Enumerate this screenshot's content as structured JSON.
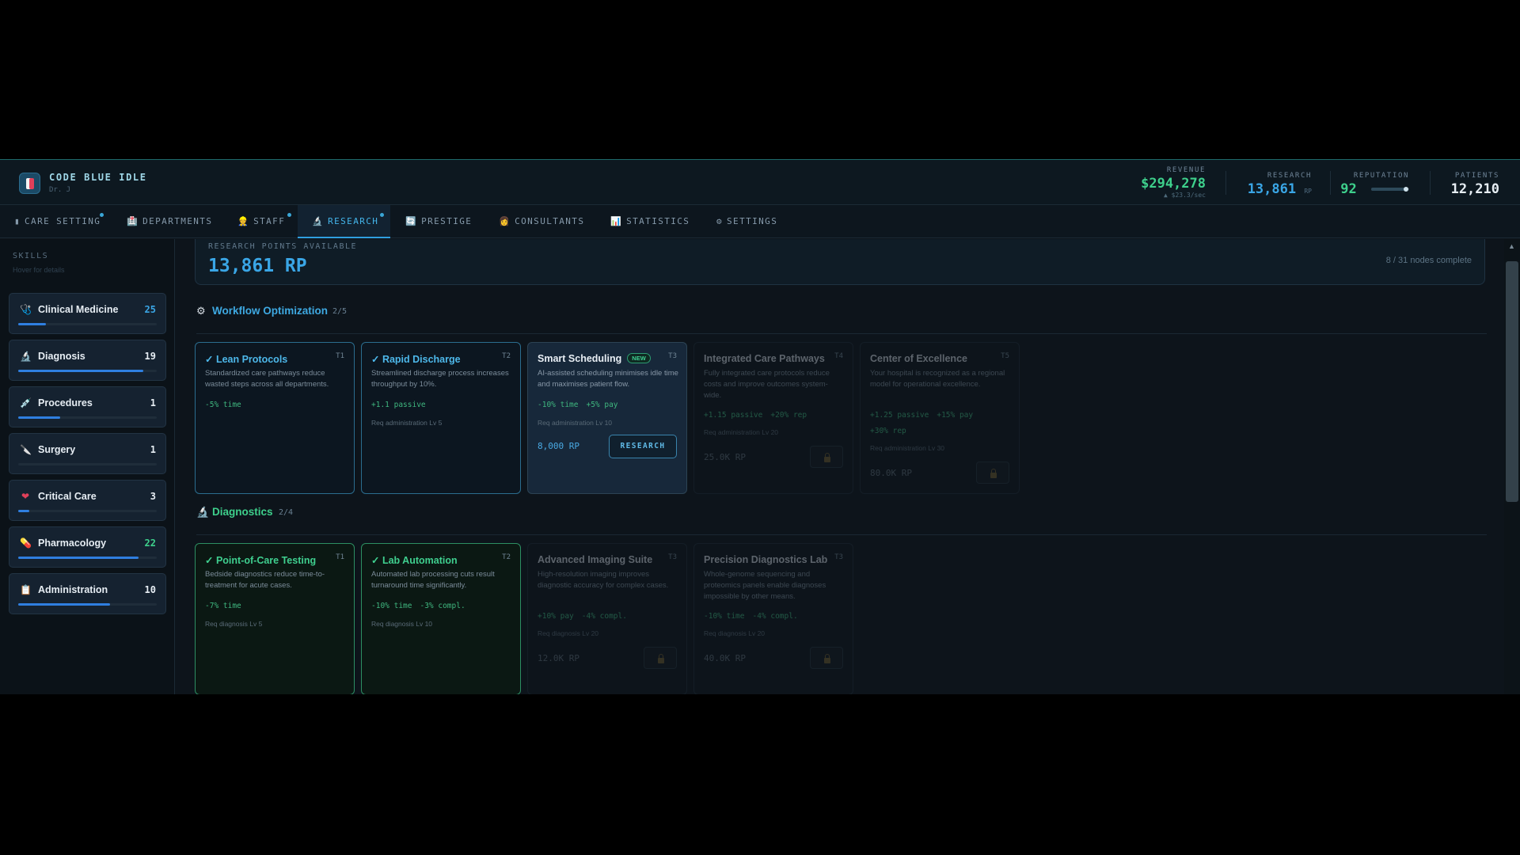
{
  "app": {
    "title": "CODE BLUE IDLE",
    "subtitle": "Dr. J"
  },
  "stats": {
    "revenue": {
      "label": "REVENUE",
      "value": "$294,278",
      "rate": "▲ $23.3/sec",
      "color": "#3ed08c"
    },
    "research": {
      "label": "RESEARCH",
      "value": "13,861",
      "unit": "RP",
      "color": "#3aa6e6"
    },
    "reputation": {
      "label": "REPUTATION",
      "value": "92",
      "level": 0.92,
      "color": "#3ed08c"
    },
    "patients": {
      "label": "PATIENTS",
      "value": "12,210",
      "color": "#e6edf3"
    }
  },
  "tabs": [
    {
      "label": "CARE SETTING",
      "icon": "bed-icon",
      "glyph": "▮",
      "notify": true,
      "active": false
    },
    {
      "label": "DEPARTMENTS",
      "icon": "hospital-icon",
      "glyph": "🏥",
      "notify": false,
      "active": false
    },
    {
      "label": "STAFF",
      "icon": "staff-icon",
      "glyph": "👷",
      "notify": true,
      "active": false
    },
    {
      "label": "RESEARCH",
      "icon": "microscope-icon",
      "glyph": "🔬",
      "notify": true,
      "active": true
    },
    {
      "label": "PRESTIGE",
      "icon": "prestige-icon",
      "glyph": "🔄",
      "notify": false,
      "active": false
    },
    {
      "label": "CONSULTANTS",
      "icon": "consultant-icon",
      "glyph": "👩",
      "notify": false,
      "active": false
    },
    {
      "label": "STATISTICS",
      "icon": "chart-icon",
      "glyph": "📊",
      "notify": false,
      "active": false
    },
    {
      "label": "SETTINGS",
      "icon": "gear-icon",
      "glyph": "⚙",
      "notify": false,
      "active": false
    }
  ],
  "sidebar": {
    "title": "SKILLS",
    "hint": "Hover for details",
    "skills": [
      {
        "name": "Clinical Medicine",
        "level": "25",
        "progress": 0.2,
        "icon": "stethoscope-icon",
        "glyph": "🩺",
        "level_color": "#3aa6e6"
      },
      {
        "name": "Diagnosis",
        "level": "19",
        "progress": 0.9,
        "icon": "microscope-icon",
        "glyph": "🔬",
        "level_color": "#e6edf3"
      },
      {
        "name": "Procedures",
        "level": "1",
        "progress": 0.3,
        "icon": "syringe-icon",
        "glyph": "💉",
        "level_color": "#e6edf3"
      },
      {
        "name": "Surgery",
        "level": "1",
        "progress": 0.0,
        "icon": "scalpel-icon",
        "glyph": "🔪",
        "level_color": "#e6edf3"
      },
      {
        "name": "Critical Care",
        "level": "3",
        "progress": 0.08,
        "icon": "heart-icon",
        "glyph": "❤",
        "level_color": "#e6edf3"
      },
      {
        "name": "Pharmacology",
        "level": "22",
        "progress": 0.87,
        "icon": "pill-icon",
        "glyph": "💊",
        "level_color": "#3ed08c"
      },
      {
        "name": "Administration",
        "level": "10",
        "progress": 0.66,
        "icon": "clipboard-icon",
        "glyph": "📋",
        "level_color": "#e6edf3"
      }
    ]
  },
  "research_panel": {
    "label": "RESEARCH POINTS AVAILABLE",
    "value": "13,861 RP",
    "nodes": "8 / 31 nodes complete"
  },
  "sections": [
    {
      "name": "Workflow Optimization",
      "count": "2/5",
      "icon": "gear-icon",
      "glyph": "⚙",
      "color": "#3ea9e2",
      "cards": [
        {
          "title": "✓ Lean Protocols",
          "tier": "T1",
          "state": "done-blue",
          "desc": "Standardized care pathways reduce wasted steps across all departments.",
          "tags": [
            "-5% time"
          ],
          "req": ""
        },
        {
          "title": "✓ Rapid Discharge",
          "tier": "T2",
          "state": "done-blue",
          "desc": "Streamlined discharge process increases throughput by 10%.",
          "tags": [
            "+1.1 passive"
          ],
          "req": "Req administration Lv 5"
        },
        {
          "title": "Smart Scheduling",
          "badge": "NEW",
          "tier": "T3",
          "state": "avail",
          "desc": "AI-assisted scheduling minimises idle time and maximises patient flow.",
          "tags": [
            "-10% time",
            "+5% pay"
          ],
          "req": "Req administration Lv 10",
          "cost": "8,000 RP",
          "button": "RESEARCH"
        },
        {
          "title": "Integrated Care Pathways",
          "tier": "T4",
          "state": "locked",
          "desc": "Fully integrated care protocols reduce costs and improve outcomes system-wide.",
          "tags": [
            "+1.15 passive",
            "+20% rep"
          ],
          "req": "Req administration Lv 20",
          "cost": "25.0K RP"
        },
        {
          "title": "Center of Excellence",
          "tier": "T5",
          "state": "locked",
          "desc": "Your hospital is recognized as a regional model for operational excellence.",
          "tags": [
            "+1.25 passive",
            "+15% pay",
            "+30% rep"
          ],
          "req": "Req administration Lv 30",
          "cost": "80.0K RP"
        }
      ]
    },
    {
      "name": "Diagnostics",
      "count": "2/4",
      "icon": "microscope-icon",
      "glyph": "🔬",
      "color": "#3ed08c",
      "cards": [
        {
          "title": "✓ Point-of-Care Testing",
          "tier": "T1",
          "state": "done-green",
          "desc": "Bedside diagnostics reduce time-to-treatment for acute cases.",
          "tags": [
            "-7% time"
          ],
          "req": "Req diagnosis Lv 5"
        },
        {
          "title": "✓ Lab Automation",
          "tier": "T2",
          "state": "done-green",
          "desc": "Automated lab processing cuts result turnaround time significantly.",
          "tags": [
            "-10% time",
            "-3% compl."
          ],
          "req": "Req diagnosis Lv 10"
        },
        {
          "title": "Advanced Imaging Suite",
          "tier": "T3",
          "state": "locked",
          "desc": "High-resolution imaging improves diagnostic accuracy for complex cases.",
          "tags": [
            "+10% pay",
            "-4% compl."
          ],
          "req": "Req diagnosis Lv 20",
          "cost": "12.0K RP"
        },
        {
          "title": "Precision Diagnostics Lab",
          "tier": "T3",
          "state": "locked",
          "desc": "Whole-genome sequencing and proteomics panels enable diagnoses impossible by other means.",
          "tags": [
            "-10% time",
            "-4% compl."
          ],
          "req": "Req diagnosis Lv 20",
          "cost": "40.0K RP"
        }
      ]
    }
  ]
}
